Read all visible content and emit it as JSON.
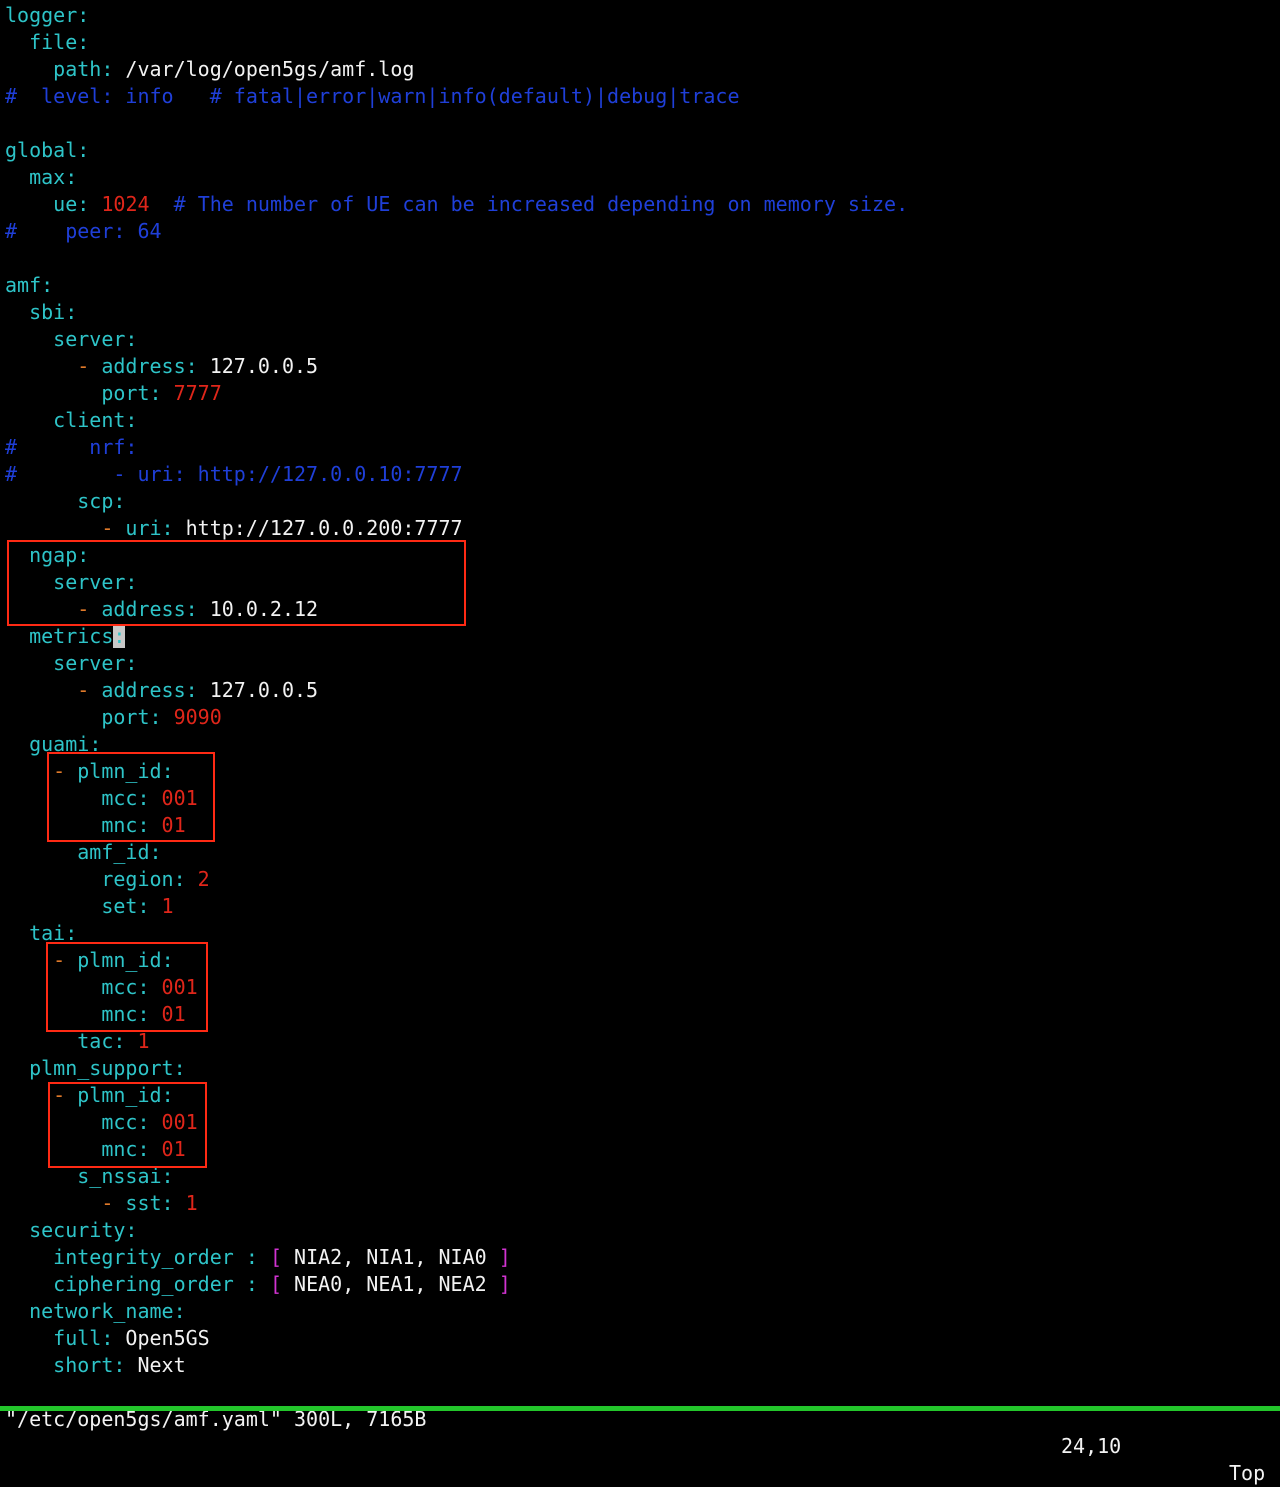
{
  "editor": {
    "lines": [
      [
        [
          "k",
          "logger"
        ],
        [
          "k",
          ":"
        ]
      ],
      [
        [
          "v",
          "  "
        ],
        [
          "k",
          "file"
        ],
        [
          "k",
          ":"
        ]
      ],
      [
        [
          "v",
          "    "
        ],
        [
          "k",
          "path"
        ],
        [
          "k",
          ":"
        ],
        [
          "v",
          " /var/log/open5gs/amf.log"
        ]
      ],
      [
        [
          "c",
          "#  level: info   # fatal|error|warn|info(default)|debug|trace"
        ]
      ],
      [],
      [
        [
          "k",
          "global"
        ],
        [
          "k",
          ":"
        ]
      ],
      [
        [
          "v",
          "  "
        ],
        [
          "k",
          "max"
        ],
        [
          "k",
          ":"
        ]
      ],
      [
        [
          "v",
          "    "
        ],
        [
          "k",
          "ue"
        ],
        [
          "k",
          ":"
        ],
        [
          "v",
          " "
        ],
        [
          "n",
          "1024"
        ],
        [
          "v",
          "  "
        ],
        [
          "c",
          "# The number of UE can be increased depending on memory size."
        ]
      ],
      [
        [
          "c",
          "#    peer: 64"
        ]
      ],
      [],
      [
        [
          "k",
          "amf"
        ],
        [
          "k",
          ":"
        ]
      ],
      [
        [
          "v",
          "  "
        ],
        [
          "k",
          "sbi"
        ],
        [
          "k",
          ":"
        ]
      ],
      [
        [
          "v",
          "    "
        ],
        [
          "k",
          "server"
        ],
        [
          "k",
          ":"
        ]
      ],
      [
        [
          "v",
          "      "
        ],
        [
          "d",
          "-"
        ],
        [
          "v",
          " "
        ],
        [
          "k",
          "address"
        ],
        [
          "k",
          ":"
        ],
        [
          "v",
          " 127.0.0.5"
        ]
      ],
      [
        [
          "v",
          "        "
        ],
        [
          "k",
          "port"
        ],
        [
          "k",
          ":"
        ],
        [
          "v",
          " "
        ],
        [
          "n",
          "7777"
        ]
      ],
      [
        [
          "v",
          "    "
        ],
        [
          "k",
          "client"
        ],
        [
          "k",
          ":"
        ]
      ],
      [
        [
          "c",
          "#      nrf:"
        ]
      ],
      [
        [
          "c",
          "#        - uri: http://127.0.0.10:7777"
        ]
      ],
      [
        [
          "v",
          "      "
        ],
        [
          "k",
          "scp"
        ],
        [
          "k",
          ":"
        ]
      ],
      [
        [
          "v",
          "        "
        ],
        [
          "d",
          "-"
        ],
        [
          "v",
          " "
        ],
        [
          "k",
          "uri"
        ],
        [
          "k",
          ":"
        ],
        [
          "v",
          " http://127.0.0.200:7777"
        ]
      ],
      [
        [
          "v",
          "  "
        ],
        [
          "k",
          "ngap"
        ],
        [
          "k",
          ":"
        ]
      ],
      [
        [
          "v",
          "    "
        ],
        [
          "k",
          "server"
        ],
        [
          "k",
          ":"
        ]
      ],
      [
        [
          "v",
          "      "
        ],
        [
          "d",
          "-"
        ],
        [
          "v",
          " "
        ],
        [
          "k",
          "address"
        ],
        [
          "k",
          ":"
        ],
        [
          "v",
          " 10.0.2.12"
        ]
      ],
      [
        [
          "v",
          "  "
        ],
        [
          "k",
          "metrics"
        ],
        [
          "cursor",
          ":"
        ]
      ],
      [
        [
          "v",
          "    "
        ],
        [
          "k",
          "server"
        ],
        [
          "k",
          ":"
        ]
      ],
      [
        [
          "v",
          "      "
        ],
        [
          "d",
          "-"
        ],
        [
          "v",
          " "
        ],
        [
          "k",
          "address"
        ],
        [
          "k",
          ":"
        ],
        [
          "v",
          " 127.0.0.5"
        ]
      ],
      [
        [
          "v",
          "        "
        ],
        [
          "k",
          "port"
        ],
        [
          "k",
          ":"
        ],
        [
          "v",
          " "
        ],
        [
          "n",
          "9090"
        ]
      ],
      [
        [
          "v",
          "  "
        ],
        [
          "k",
          "guami"
        ],
        [
          "k",
          ":"
        ]
      ],
      [
        [
          "v",
          "    "
        ],
        [
          "d",
          "-"
        ],
        [
          "v",
          " "
        ],
        [
          "k",
          "plmn_id"
        ],
        [
          "k",
          ":"
        ]
      ],
      [
        [
          "v",
          "        "
        ],
        [
          "k",
          "mcc"
        ],
        [
          "k",
          ":"
        ],
        [
          "v",
          " "
        ],
        [
          "n",
          "001"
        ]
      ],
      [
        [
          "v",
          "        "
        ],
        [
          "k",
          "mnc"
        ],
        [
          "k",
          ":"
        ],
        [
          "v",
          " "
        ],
        [
          "n",
          "01"
        ]
      ],
      [
        [
          "v",
          "      "
        ],
        [
          "k",
          "amf_id"
        ],
        [
          "k",
          ":"
        ]
      ],
      [
        [
          "v",
          "        "
        ],
        [
          "k",
          "region"
        ],
        [
          "k",
          ":"
        ],
        [
          "v",
          " "
        ],
        [
          "n",
          "2"
        ]
      ],
      [
        [
          "v",
          "        "
        ],
        [
          "k",
          "set"
        ],
        [
          "k",
          ":"
        ],
        [
          "v",
          " "
        ],
        [
          "n",
          "1"
        ]
      ],
      [
        [
          "v",
          "  "
        ],
        [
          "k",
          "tai"
        ],
        [
          "k",
          ":"
        ]
      ],
      [
        [
          "v",
          "    "
        ],
        [
          "d",
          "-"
        ],
        [
          "v",
          " "
        ],
        [
          "k",
          "plmn_id"
        ],
        [
          "k",
          ":"
        ]
      ],
      [
        [
          "v",
          "        "
        ],
        [
          "k",
          "mcc"
        ],
        [
          "k",
          ":"
        ],
        [
          "v",
          " "
        ],
        [
          "n",
          "001"
        ]
      ],
      [
        [
          "v",
          "        "
        ],
        [
          "k",
          "mnc"
        ],
        [
          "k",
          ":"
        ],
        [
          "v",
          " "
        ],
        [
          "n",
          "01"
        ]
      ],
      [
        [
          "v",
          "      "
        ],
        [
          "k",
          "tac"
        ],
        [
          "k",
          ":"
        ],
        [
          "v",
          " "
        ],
        [
          "n",
          "1"
        ]
      ],
      [
        [
          "v",
          "  "
        ],
        [
          "k",
          "plmn_support"
        ],
        [
          "k",
          ":"
        ]
      ],
      [
        [
          "v",
          "    "
        ],
        [
          "d",
          "-"
        ],
        [
          "v",
          " "
        ],
        [
          "k",
          "plmn_id"
        ],
        [
          "k",
          ":"
        ]
      ],
      [
        [
          "v",
          "        "
        ],
        [
          "k",
          "mcc"
        ],
        [
          "k",
          ":"
        ],
        [
          "v",
          " "
        ],
        [
          "n",
          "001"
        ]
      ],
      [
        [
          "v",
          "        "
        ],
        [
          "k",
          "mnc"
        ],
        [
          "k",
          ":"
        ],
        [
          "v",
          " "
        ],
        [
          "n",
          "01"
        ]
      ],
      [
        [
          "v",
          "      "
        ],
        [
          "k",
          "s_nssai"
        ],
        [
          "k",
          ":"
        ]
      ],
      [
        [
          "v",
          "        "
        ],
        [
          "d",
          "-"
        ],
        [
          "v",
          " "
        ],
        [
          "k",
          "sst"
        ],
        [
          "k",
          ":"
        ],
        [
          "v",
          " "
        ],
        [
          "n",
          "1"
        ]
      ],
      [
        [
          "v",
          "  "
        ],
        [
          "k",
          "security"
        ],
        [
          "k",
          ":"
        ]
      ],
      [
        [
          "v",
          "    "
        ],
        [
          "k",
          "integrity_order"
        ],
        [
          "v",
          " "
        ],
        [
          "k",
          ":"
        ],
        [
          "v",
          " "
        ],
        [
          "b",
          "["
        ],
        [
          "v",
          " NIA2, NIA1, NIA0 "
        ],
        [
          "b",
          "]"
        ]
      ],
      [
        [
          "v",
          "    "
        ],
        [
          "k",
          "ciphering_order"
        ],
        [
          "v",
          " "
        ],
        [
          "k",
          ":"
        ],
        [
          "v",
          " "
        ],
        [
          "b",
          "["
        ],
        [
          "v",
          " NEA0, NEA1, NEA2 "
        ],
        [
          "b",
          "]"
        ]
      ],
      [
        [
          "v",
          "  "
        ],
        [
          "k",
          "network_name"
        ],
        [
          "k",
          ":"
        ]
      ],
      [
        [
          "v",
          "    "
        ],
        [
          "k",
          "full"
        ],
        [
          "k",
          ":"
        ],
        [
          "v",
          " Open5GS"
        ]
      ],
      [
        [
          "v",
          "    "
        ],
        [
          "k",
          "short"
        ],
        [
          "k",
          ":"
        ],
        [
          "v",
          " Next"
        ]
      ]
    ]
  },
  "statusbar": {
    "filename": "\"/etc/open5gs/amf.yaml\" 300L, 7165B",
    "position": "24,10",
    "scroll": "Top"
  },
  "colors": {
    "key": "#2ec4c8",
    "value": "#f2f2f2",
    "number": "#e0261a",
    "dash": "#e07a2a",
    "comment": "#1f3fd8",
    "bracket": "#d233d2",
    "highlight_box": "#ff2a14",
    "status_underline": "#23c62b"
  }
}
